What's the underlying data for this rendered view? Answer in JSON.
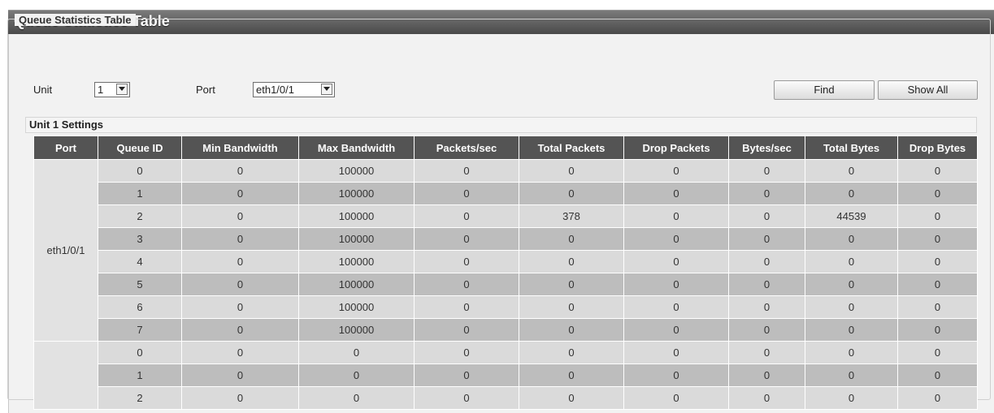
{
  "page": {
    "title": "Queue Statistics Table"
  },
  "form": {
    "legend": "Queue Statistics Table",
    "unit_label": "Unit",
    "unit_value": "1",
    "port_label": "Port",
    "port_value": "eth1/0/1",
    "find_label": "Find",
    "show_all_label": "Show All"
  },
  "settings": {
    "title": "Unit 1 Settings"
  },
  "table": {
    "headers": [
      "Port",
      "Queue ID",
      "Min Bandwidth",
      "Max Bandwidth",
      "Packets/sec",
      "Total Packets",
      "Drop Packets",
      "Bytes/sec",
      "Total Bytes",
      "Drop Bytes"
    ],
    "groups": [
      {
        "port": "eth1/0/1",
        "rows": [
          [
            "0",
            "0",
            "100000",
            "0",
            "0",
            "0",
            "0",
            "0",
            "0"
          ],
          [
            "1",
            "0",
            "100000",
            "0",
            "0",
            "0",
            "0",
            "0",
            "0"
          ],
          [
            "2",
            "0",
            "100000",
            "0",
            "378",
            "0",
            "0",
            "44539",
            "0"
          ],
          [
            "3",
            "0",
            "100000",
            "0",
            "0",
            "0",
            "0",
            "0",
            "0"
          ],
          [
            "4",
            "0",
            "100000",
            "0",
            "0",
            "0",
            "0",
            "0",
            "0"
          ],
          [
            "5",
            "0",
            "100000",
            "0",
            "0",
            "0",
            "0",
            "0",
            "0"
          ],
          [
            "6",
            "0",
            "100000",
            "0",
            "0",
            "0",
            "0",
            "0",
            "0"
          ],
          [
            "7",
            "0",
            "100000",
            "0",
            "0",
            "0",
            "0",
            "0",
            "0"
          ]
        ]
      },
      {
        "port": "",
        "rows": [
          [
            "0",
            "0",
            "0",
            "0",
            "0",
            "0",
            "0",
            "0",
            "0"
          ],
          [
            "1",
            "0",
            "0",
            "0",
            "0",
            "0",
            "0",
            "0",
            "0"
          ],
          [
            "2",
            "0",
            "0",
            "0",
            "0",
            "0",
            "0",
            "0",
            "0"
          ]
        ]
      }
    ]
  }
}
